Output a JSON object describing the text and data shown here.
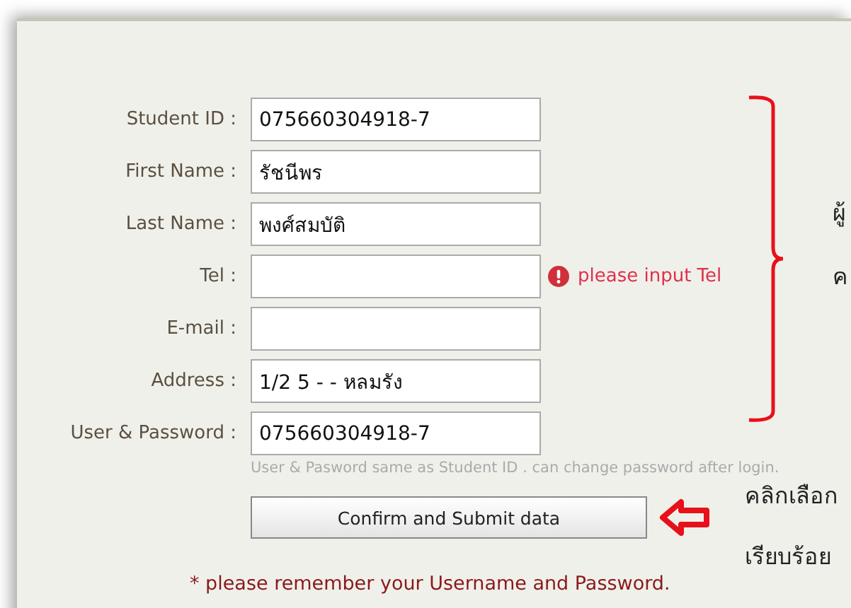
{
  "form": {
    "fields": [
      {
        "label": "Student ID :",
        "value": "075660304918-7"
      },
      {
        "label": "First Name :",
        "value": "รัชนีพร"
      },
      {
        "label": "Last Name :",
        "value": "พงศ์สมบัติ"
      },
      {
        "label": "Tel :",
        "error": "please input Tel"
      },
      {
        "label": "E-mail :"
      },
      {
        "label": "Address :",
        "value": "1/2 5 - - หลมรัง"
      },
      {
        "label": "User & Password :",
        "value": "075660304918-7",
        "hint": "User & Pasword same as Student ID . can change password after login."
      }
    ],
    "submit": "Confirm and Submit data",
    "reminder": "* please remember your Username and Password."
  },
  "annotations": {
    "bracket_notes": [
      "ผู้",
      "ค"
    ],
    "button_notes": [
      "คลิกเลือก",
      "เรียบร้อย"
    ]
  }
}
